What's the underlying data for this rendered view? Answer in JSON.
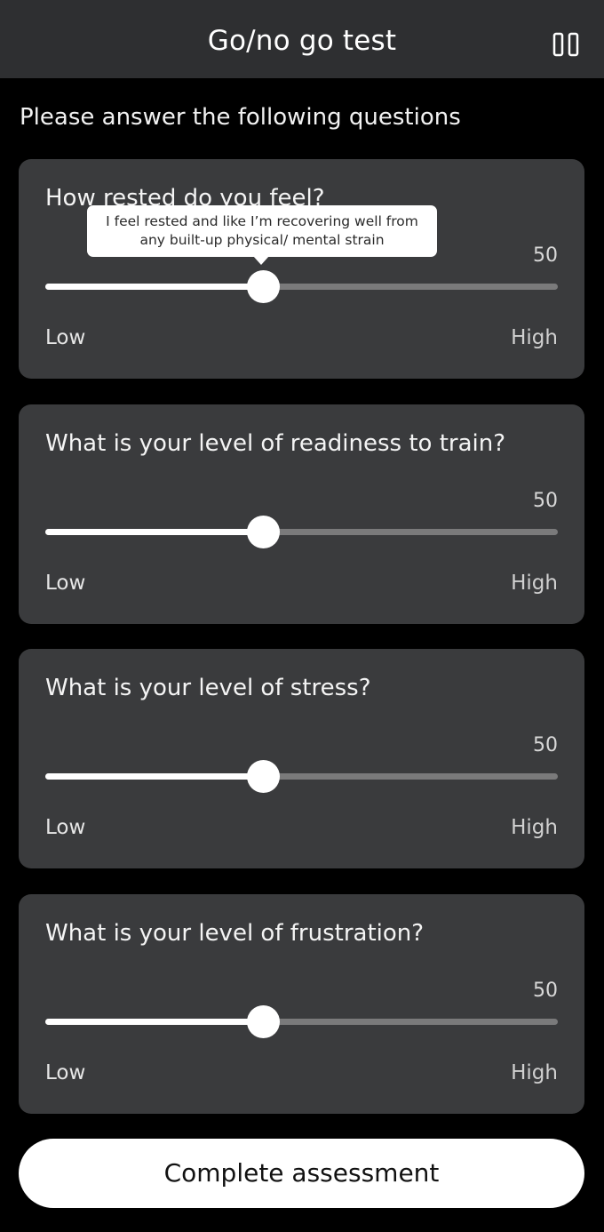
{
  "header": {
    "title": "Go/no go test",
    "pause_icon": "pause-icon"
  },
  "intro": "Please answer the following questions",
  "questions": [
    {
      "label": "How rested do you feel?",
      "value": "50",
      "value_fraction": 0.425,
      "low_label": "Low",
      "high_label": "High",
      "tooltip": "I feel rested and like I’m recovering well from any built-up physical/ mental strain"
    },
    {
      "label": "What is your level of readiness to train?",
      "value": "50",
      "value_fraction": 0.425,
      "low_label": "Low",
      "high_label": "High"
    },
    {
      "label": "What is your level of stress?",
      "value": "50",
      "value_fraction": 0.425,
      "low_label": "Low",
      "high_label": "High"
    },
    {
      "label": "What is your level of frustration?",
      "value": "50",
      "value_fraction": 0.425,
      "low_label": "Low",
      "high_label": "High"
    }
  ],
  "complete_button": "Complete assessment",
  "colors": {
    "background": "#000000",
    "header": "#2e2f31",
    "card": "#3a3b3d",
    "track": "#7a7a7b",
    "fill": "#ffffff"
  }
}
